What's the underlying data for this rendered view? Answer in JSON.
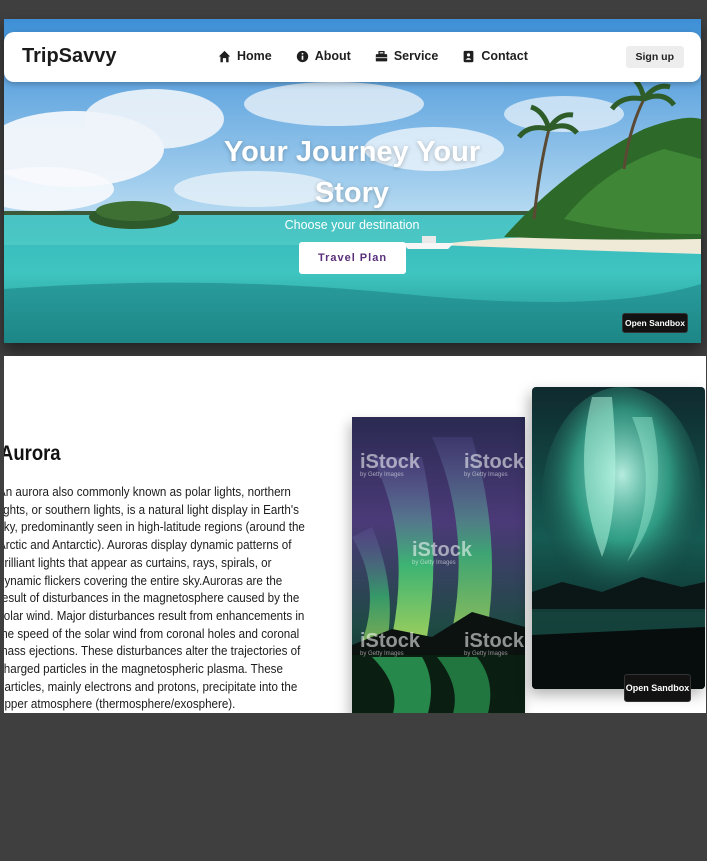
{
  "navbar": {
    "brand": "TripSavvy",
    "links": [
      {
        "label": "Home",
        "icon": "home-icon"
      },
      {
        "label": "About",
        "icon": "info-icon"
      },
      {
        "label": "Service",
        "icon": "briefcase-icon"
      },
      {
        "label": "Contact",
        "icon": "contact-card-icon"
      }
    ],
    "signup_label": "Sign up"
  },
  "hero": {
    "title": "Your Journey Your Story",
    "subtitle": "Choose your destination",
    "cta_label": "Travel Plan",
    "sandbox_label": "Open Sandbox"
  },
  "aurora": {
    "title": "Aurora",
    "description": "An aurora also commonly known as polar lights, northern lights, or southern lights, is a natural light display in Earth's sky, predominantly seen in high-latitude regions (around the Arctic and Antarctic). Auroras display dynamic patterns of brilliant lights that appear as curtains, rays, spirals, or dynamic flickers covering the entire sky.Auroras are the result of disturbances in the magnetosphere caused by the solar wind. Major disturbances result from enhancements in the speed of the solar wind from coronal holes and coronal mass ejections. These disturbances alter the trajectories of charged particles in the magnetospheric plasma. These particles, mainly electrons and protons, precipitate into the upper atmosphere (thermosphere/exosphere).",
    "watermark": "iStock",
    "watermark_sub": "by Getty Images",
    "sandbox_label": "Open Sandbox"
  },
  "colors": {
    "background": "#3f3f3f",
    "cta_text": "#5a2f7a",
    "sea": "#3fc5c0",
    "aurora_green": "#3ee07a"
  }
}
